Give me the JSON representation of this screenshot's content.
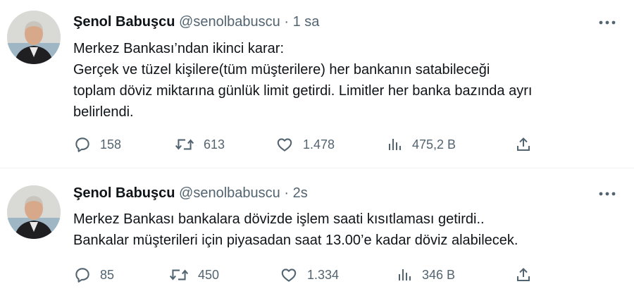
{
  "tweets": [
    {
      "name": "Şenol Babuşcu",
      "handle": "@senolbabuscu",
      "separator": "·",
      "time": "1 sa",
      "text": "Merkez  Bankası’ndan ikinci karar:\nGerçek ve tüzel kişilere(tüm müşterilere) her bankanın satabileceği\ntoplam döviz miktarına günlük limit getirdi. Limitler her banka bazında ayrı\nbelirlendi.",
      "replies": "158",
      "retweets": "613",
      "likes": "1.478",
      "views": "475,2 B"
    },
    {
      "name": "Şenol Babuşcu",
      "handle": "@senolbabuscu",
      "separator": "·",
      "time": "2s",
      "text": "Merkez Bankası bankalara dövizde işlem saati kısıtlaması getirdi..\nBankalar müşterileri için piyasadan saat 13.00’e kadar döviz alabilecek.",
      "replies": "85",
      "retweets": "450",
      "likes": "1.334",
      "views": "346 B"
    }
  ],
  "icons": {
    "reply": "reply-icon",
    "retweet": "retweet-icon",
    "like": "heart-icon",
    "views": "views-icon",
    "share": "share-icon",
    "more": "more-icon"
  },
  "colors": {
    "text": "#0f1419",
    "muted": "#536471",
    "divider": "#eff3f4"
  }
}
